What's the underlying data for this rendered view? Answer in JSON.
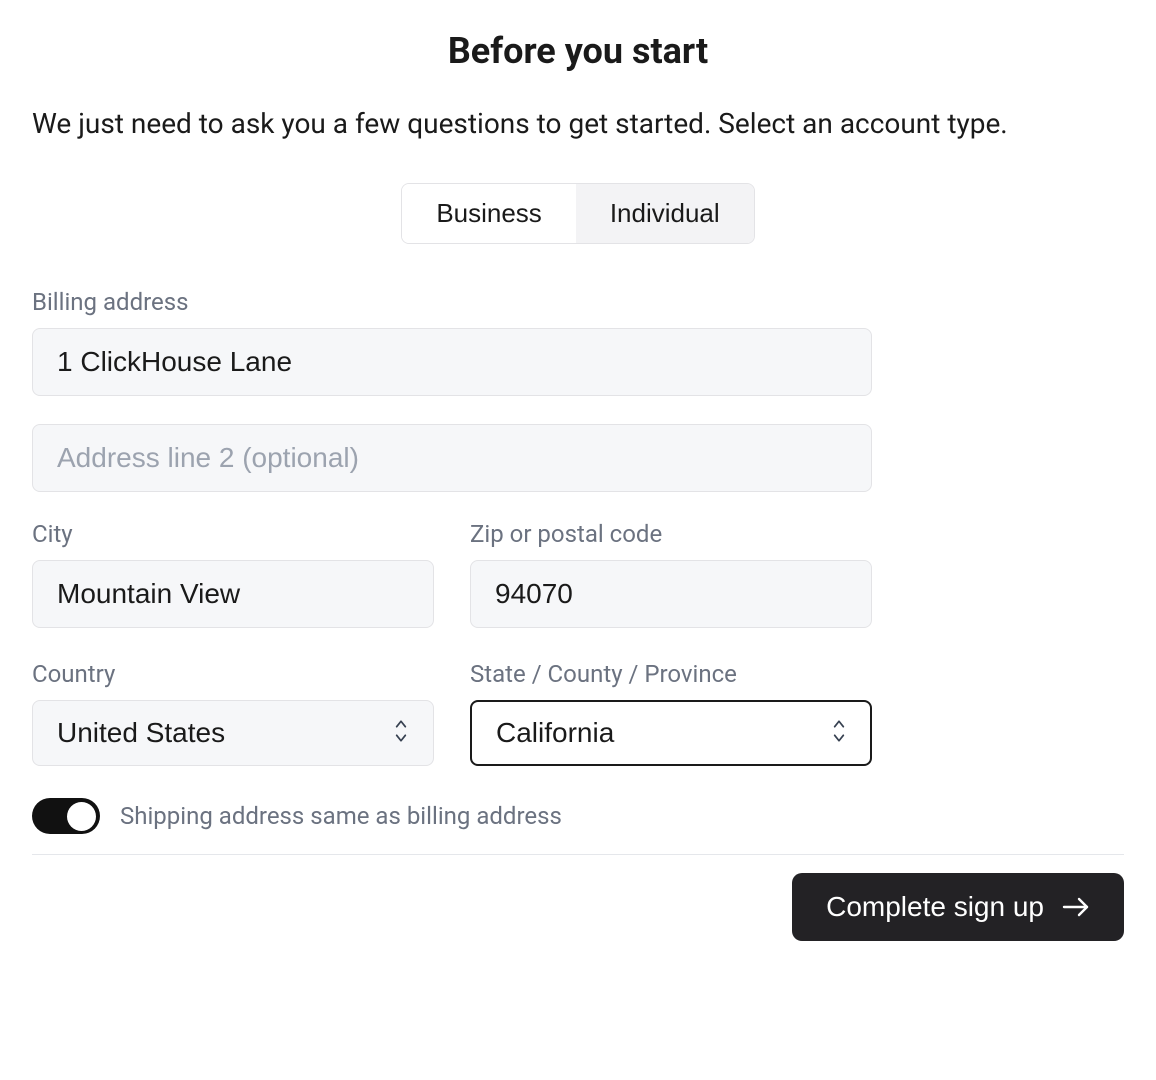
{
  "header": {
    "title": "Before you start",
    "intro": "We just need to ask you a few questions to get started. Select an account type."
  },
  "account_type": {
    "options": {
      "business": "Business",
      "individual": "Individual"
    },
    "selected": "individual"
  },
  "billing": {
    "label": "Billing address",
    "address_line_1": "1 ClickHouse Lane",
    "address_line_2": "",
    "address_line_2_placeholder": "Address line 2 (optional)",
    "city_label": "City",
    "city": "Mountain View",
    "zip_label": "Zip or postal code",
    "zip": "94070",
    "country_label": "Country",
    "country": "United States",
    "state_label": "State / County / Province",
    "state": "California"
  },
  "shipping_same": {
    "label": "Shipping address same as billing address",
    "value": true
  },
  "footer": {
    "complete_label": "Complete sign up"
  }
}
